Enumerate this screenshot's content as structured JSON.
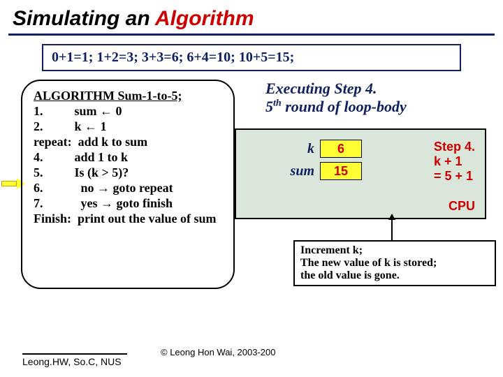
{
  "title": {
    "black": "Simulating an ",
    "red": "Algorithm"
  },
  "sequence": "0+1=1;  1+2=3;  3+3=6;  6+4=10;  10+5=15;",
  "algo": {
    "head": "ALGORITHM Sum-1-to-5;",
    "l1": "1.          sum ← 0",
    "l2": "2.          k ← 1",
    "l3": "repeat:  add k to sum",
    "l4": "4.          add 1 to k",
    "l5": "5.          Is (k > 5)?",
    "l6": "6.            no → goto repeat",
    "l7": "7.            yes → goto finish",
    "l8": "Finish:  print out the value of sum"
  },
  "exec": {
    "line1": "Executing Step 4.",
    "line2a": " 5",
    "sup": "th",
    "line2b": " round of loop-body"
  },
  "cpu": {
    "k_label": "k",
    "k_val": "6",
    "sum_label": "sum",
    "sum_val": "15",
    "step_a": "Step 4.",
    "step_b": "k + 1",
    "step_c": "= 5 + 1",
    "cpu_label": "CPU"
  },
  "note": {
    "a": "Increment k;",
    "b": "The new value of k is stored;",
    "c": "the old value is gone."
  },
  "copyright": "© Leong Hon Wai, 2003-200",
  "footer": "Leong.HW, So.C, NUS"
}
